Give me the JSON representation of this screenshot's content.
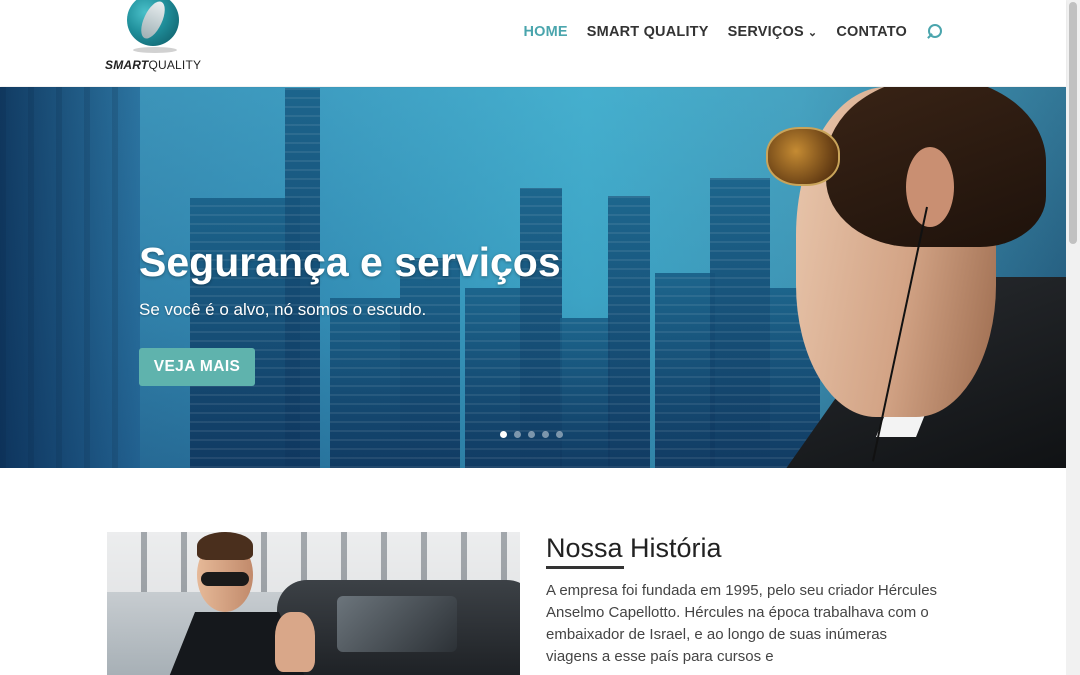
{
  "header": {
    "logo_text_bold": "SMART",
    "logo_text_rest": "QUALITY",
    "nav": [
      {
        "label": "HOME",
        "active": true
      },
      {
        "label": "SMART QUALITY",
        "active": false
      },
      {
        "label": "SERVIÇOS",
        "active": false,
        "has_dropdown": true
      },
      {
        "label": "CONTATO",
        "active": false
      }
    ],
    "search_icon": "search-icon"
  },
  "hero": {
    "title": "Segurança e serviços",
    "subtitle": "Se você é o alvo, nó somos o escudo.",
    "button_label": "VEJA MAIS",
    "slides_total": 5,
    "active_slide": 1
  },
  "history": {
    "title": "Nossa História",
    "text": "A empresa foi fundada em 1995, pelo seu criador Hércules Anselmo Capellotto. Hércules na época trabalhava com o embaixador de Israel, e ao longo de suas inúmeras viagens a esse país para cursos e"
  },
  "colors": {
    "accent": "#4aa5ad",
    "button": "#5fb3ad",
    "text": "#333333"
  }
}
